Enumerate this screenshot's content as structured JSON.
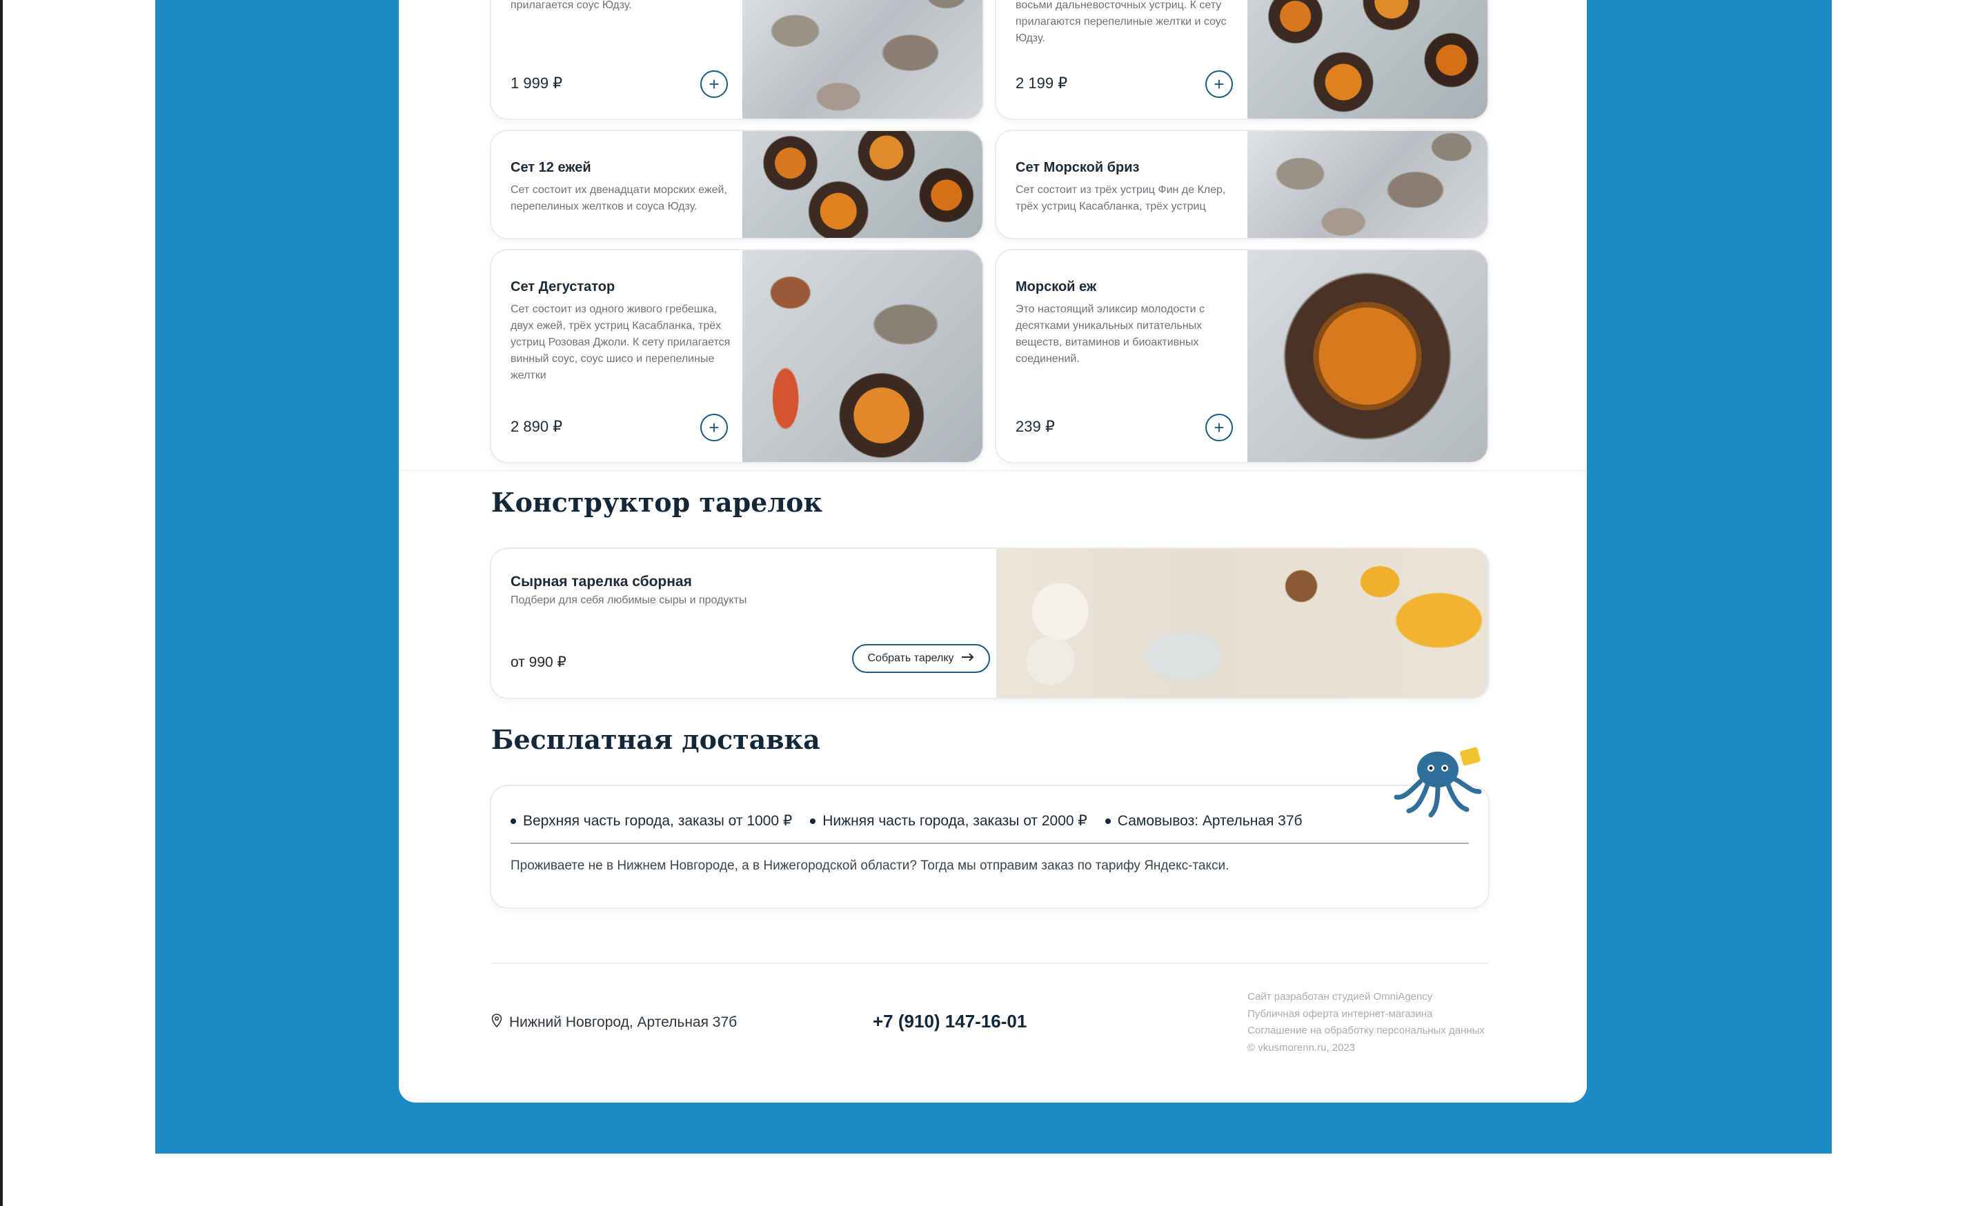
{
  "products": [
    {
      "name": "",
      "description": "прилагается соус Юдзу.",
      "price": "1 999 ₽"
    },
    {
      "name": "",
      "description": "восьми дальневосточных устриц. К сету прилагаются перепелиные желтки и соус Юдзу.",
      "price": "2 199 ₽"
    },
    {
      "name": "Сет 12 ежей",
      "description": "Сет состоит их двенадцати морских ежей, перепелиных желтков и соуса Юдзу.",
      "price": ""
    },
    {
      "name": "Сет Морской бриз",
      "description": "Сет состоит из трёх устриц Фин де Клер, трёх устриц Касабланка, трёх устриц Розовая Джоли, трёх морских ежей.",
      "price": ""
    },
    {
      "name": "Сет Дегустатор",
      "description": "Сет состоит из одного живого гребешка, двух ежей, трёх устриц Касабланка, трёх устриц Розовая Джоли. К сету прилагается винный соус, соус шисо и перепелиные желтки",
      "price": "2 890 ₽"
    },
    {
      "name": "Морской еж",
      "description": "Это настоящий эликсир молодости с десятками уникальных питательных веществ, витаминов и биоактивных соединений.",
      "price": "239 ₽"
    }
  ],
  "constructor": {
    "title": "Конструктор тарелок",
    "card_name": "Сырная тарелка сборная",
    "card_desc": "Подбери для себя любимые сыры и продукты",
    "card_price": "от 990 ₽",
    "build_label": "Собрать тарелку"
  },
  "delivery": {
    "title": "Бесплатная доставка",
    "items": [
      "Верхняя часть города, заказы от 1000 ₽",
      "Нижняя часть города, заказы от 2000 ₽",
      "Самовывоз: Артельная 37б"
    ],
    "note": "Проживаете не в Нижнем Новгороде, а в Нижегородской области? Тогда мы отправим заказ по тарифу Яндекс-такси."
  },
  "footer": {
    "address": "Нижний Новгород, Артельная 37б",
    "phone": "+7 (910) 147-16-01",
    "links": [
      "Сайт разработан студией OmniAgency",
      "Публичная оферта интернет-магазина",
      "Соглашение на обработку персональных данных",
      "© vkusmorenn.ru, 2023"
    ]
  },
  "colors": {
    "page_bg": "#1c8ac4",
    "accent": "#1a5a80",
    "title": "#12283a"
  },
  "icons": {
    "add": "plus-circle-icon",
    "arrow": "arrow-right-icon",
    "location": "map-pin-icon",
    "mascot": "octopus-icon"
  }
}
